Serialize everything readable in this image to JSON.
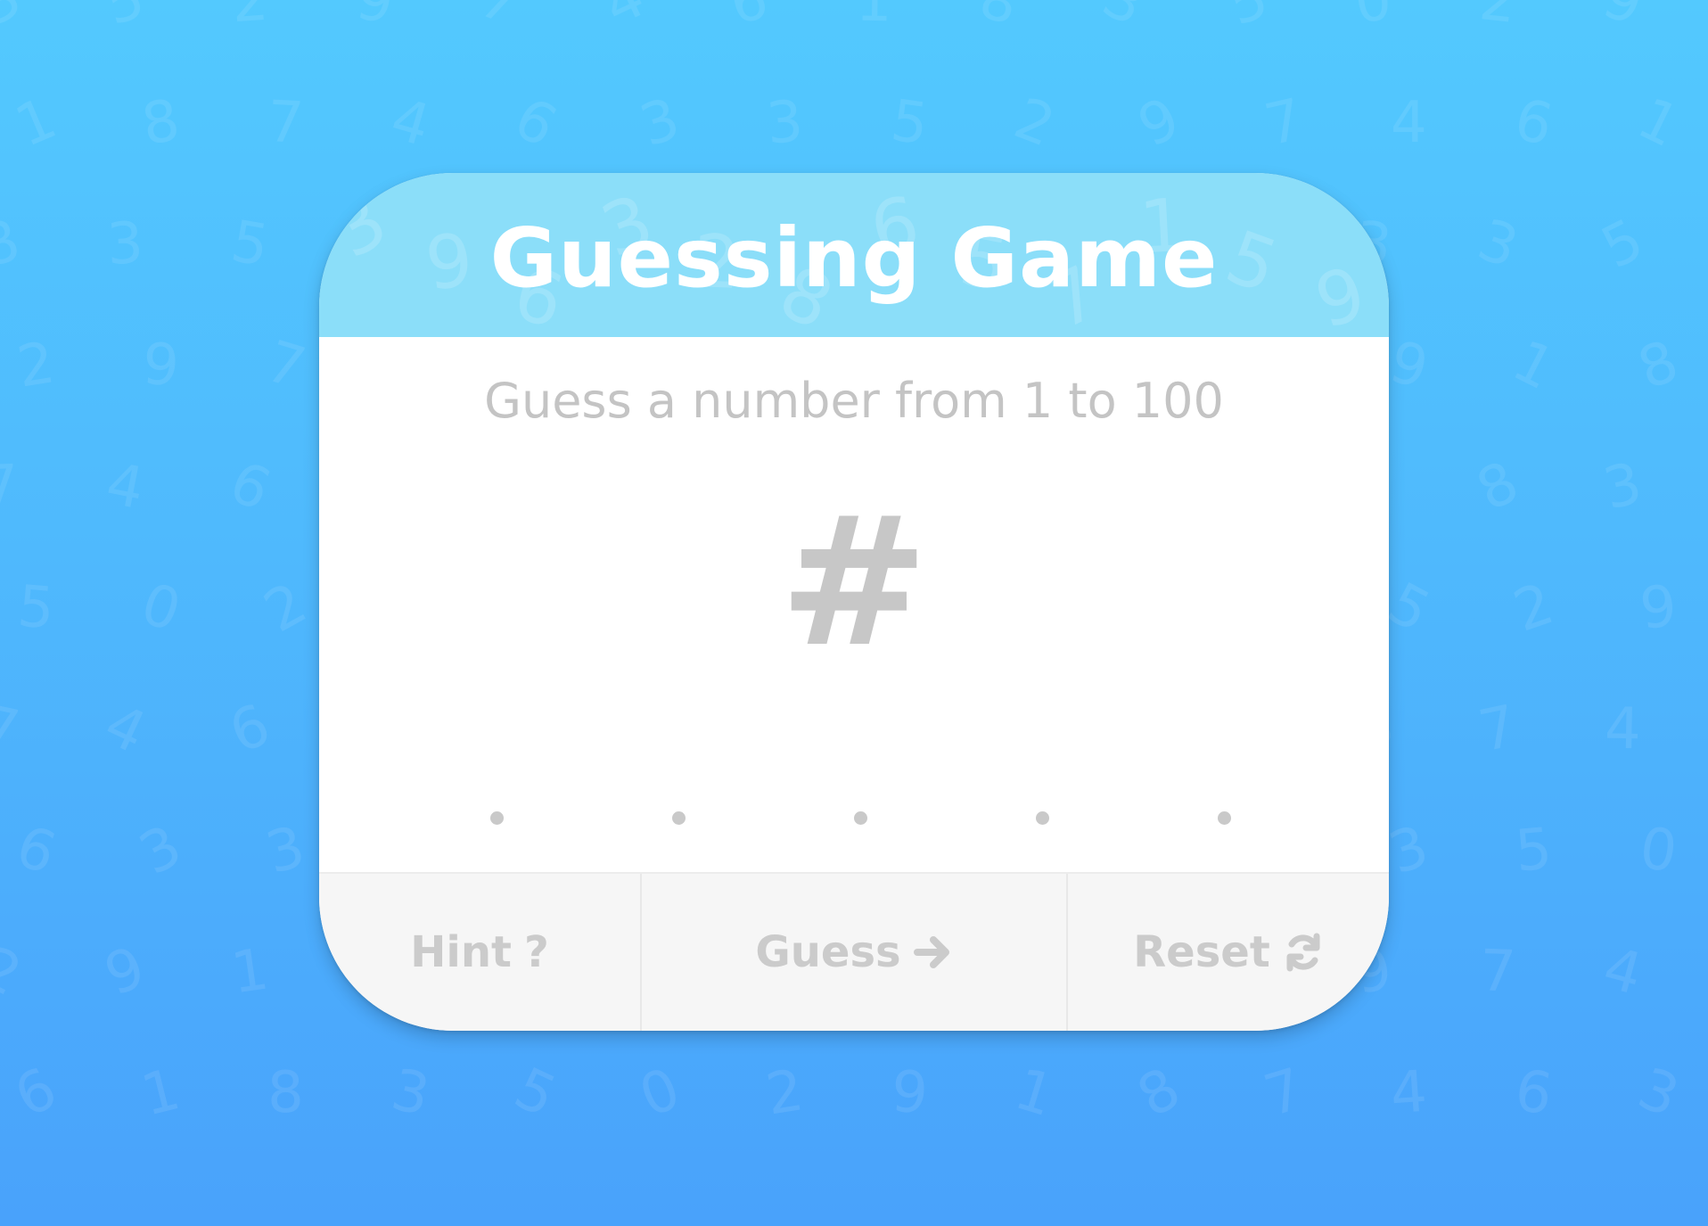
{
  "game": {
    "title": "Guessing Game",
    "subtitle": "Guess a number from 1 to 100",
    "display_value": "#",
    "attempt_dots": 5
  },
  "buttons": {
    "hint_label": "Hint",
    "hint_icon": "question-mark-icon",
    "guess_label": "Guess",
    "guess_icon": "arrow-right-icon",
    "reset_label": "Reset",
    "reset_icon": "refresh-icon"
  },
  "colors": {
    "background_top": "#53c9fe",
    "background_bottom": "#49a2fb",
    "header": "#6ed6f8",
    "muted_text": "#c4c4c4"
  },
  "background_digits": [
    "3",
    "5",
    "2",
    "9",
    "7",
    "4",
    "6",
    "1",
    "8",
    "3",
    "5",
    "0",
    "2",
    "9",
    "1",
    "8",
    "7",
    "4",
    "6",
    "3"
  ]
}
